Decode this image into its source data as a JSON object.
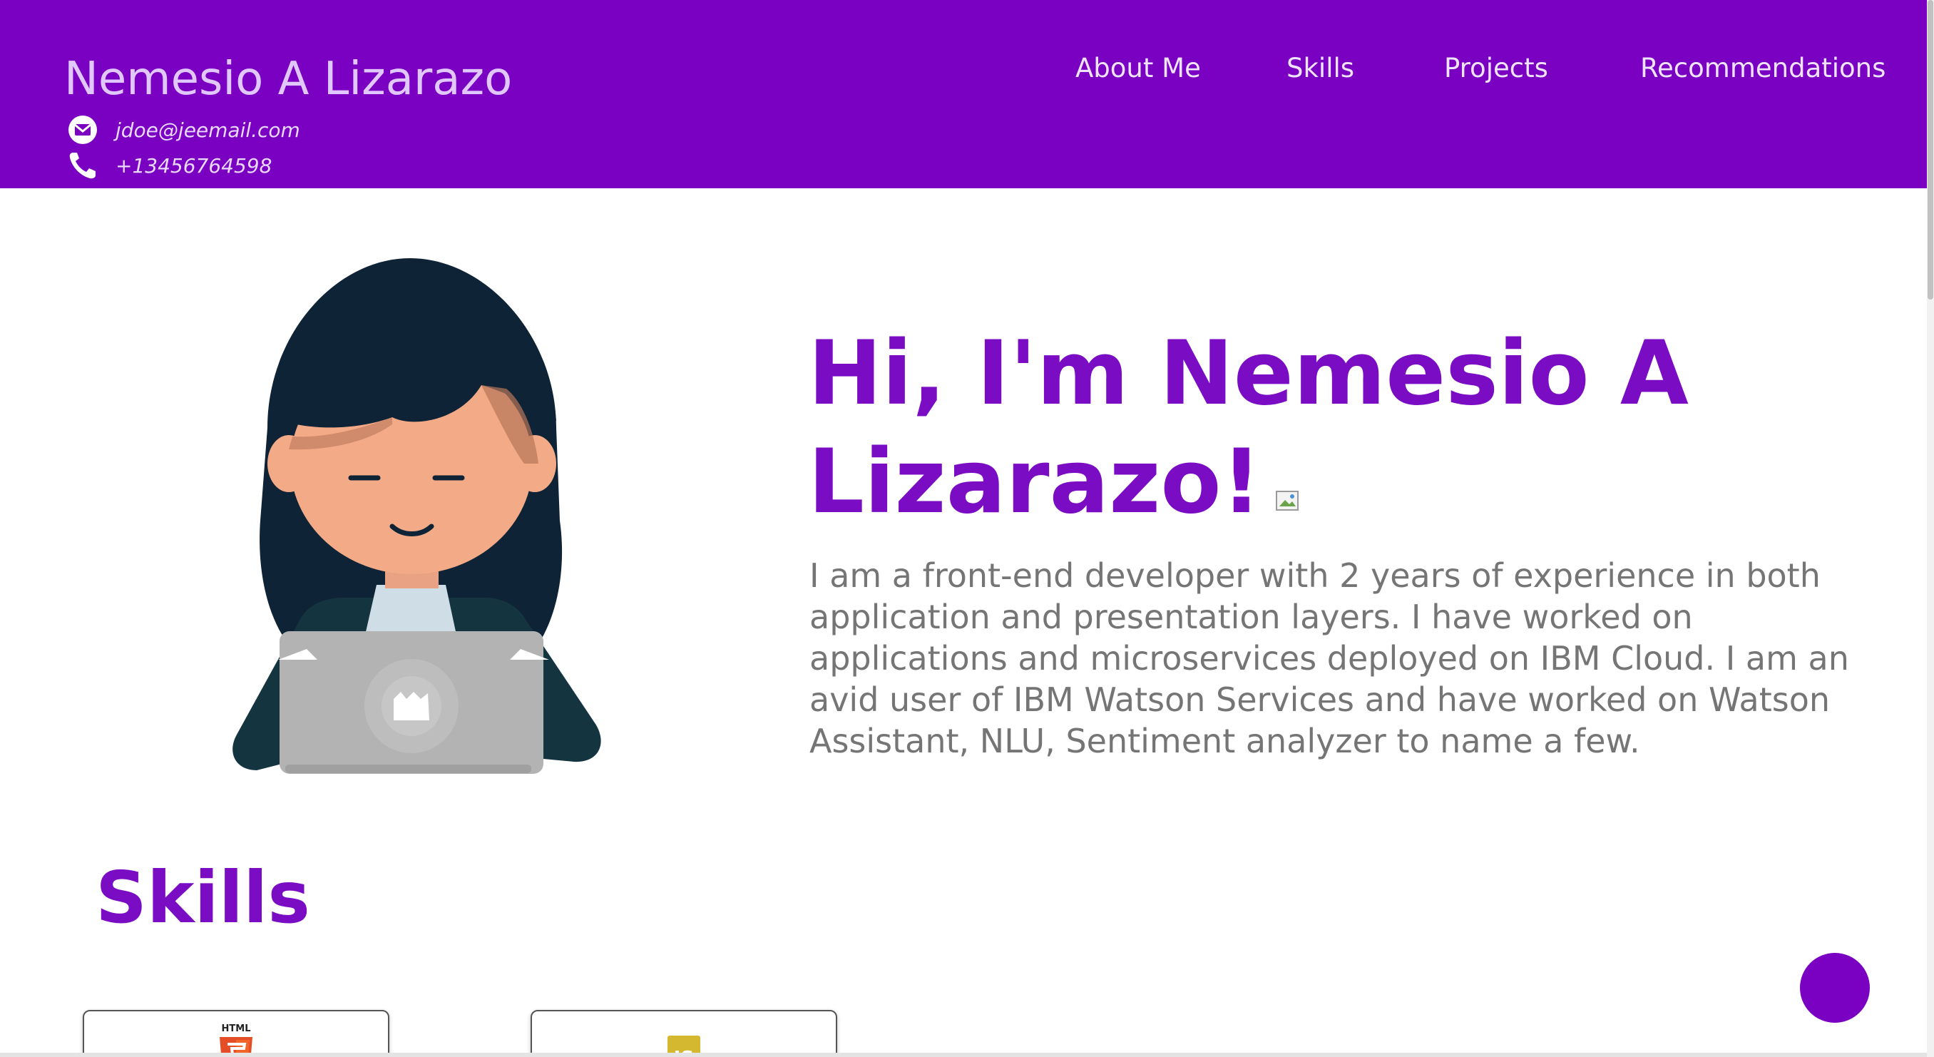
{
  "header": {
    "name": "Nemesio A Lizarazo",
    "email": "jdoe@jeemail.com",
    "phone": "+13456764598",
    "nav": [
      "About Me",
      "Skills",
      "Projects",
      "Recommendations"
    ],
    "background_color": "#7a00c2"
  },
  "hero": {
    "title": "Hi, I'm Nemesio A Lizarazo!",
    "bio": "I am a front-end developer with 2 years of experience in both application and presentation layers. I have worked on applications and microservices deployed on IBM Cloud. I am an avid user of IBM Watson Services and have worked on Watson Assistant, NLU, Sentiment analyzer to name a few.",
    "accent_color": "#7a0cc4"
  },
  "skills": {
    "heading": "Skills",
    "cards": [
      {
        "icon": "html5-logo-icon",
        "logo_text": "HTML",
        "color": "#e44d26"
      },
      {
        "icon": "javascript-logo-icon",
        "logo_text": "JS",
        "color": "#d4b830"
      }
    ]
  },
  "icons": {
    "email": "email-icon",
    "phone": "phone-icon",
    "fab": "scroll-top-button"
  }
}
